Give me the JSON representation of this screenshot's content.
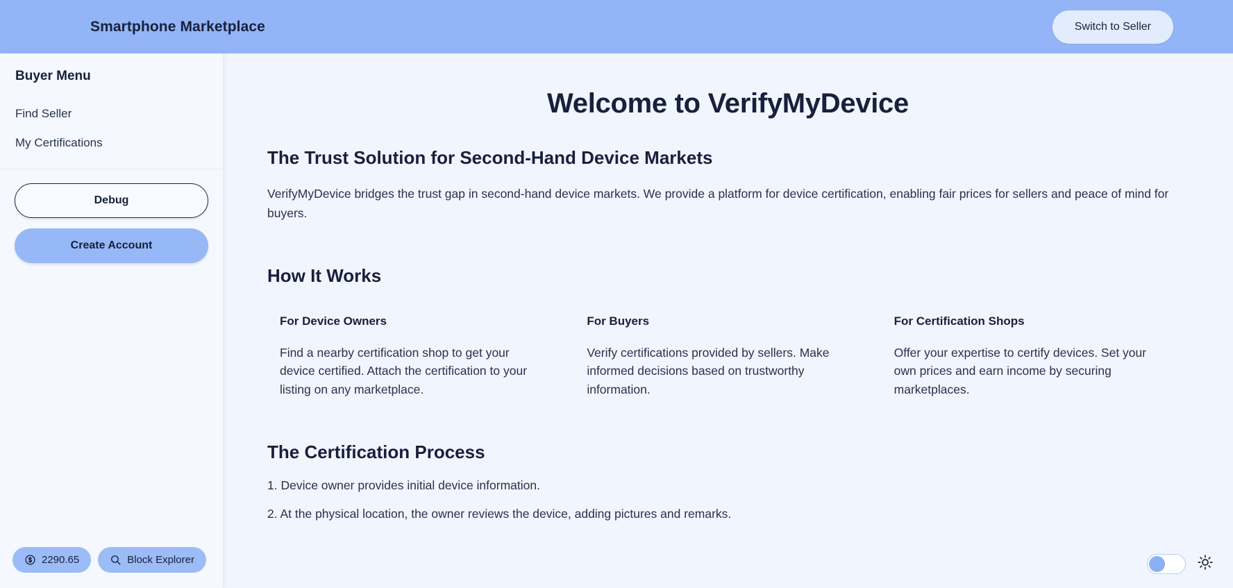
{
  "header": {
    "title": "Smartphone Marketplace",
    "switch_label": "Switch to Seller",
    "bg_color": "#93b5f7"
  },
  "sidebar": {
    "heading": "Buyer Menu",
    "items": [
      {
        "label": "Find Seller"
      },
      {
        "label": "My Certifications"
      }
    ],
    "actions": {
      "debug_label": "Debug",
      "create_account_label": "Create Account"
    },
    "footer": {
      "balance": "2290.65",
      "balance_icon": "dollar-circle-icon",
      "explorer_label": "Block Explorer",
      "explorer_icon": "search-icon"
    }
  },
  "main": {
    "page_title": "Welcome to VerifyMyDevice",
    "trust_heading": "The Trust Solution for Second-Hand Device Markets",
    "trust_paragraph": "VerifyMyDevice bridges the trust gap in second-hand device markets. We provide a platform for device certification, enabling fair prices for sellers and peace of mind for buyers.",
    "how_it_works_heading": "How It Works",
    "columns": [
      {
        "title": "For Device Owners",
        "body": "Find a nearby certification shop to get your device certified. Attach the certification to your listing on any marketplace."
      },
      {
        "title": "For Buyers",
        "body": "Verify certifications provided by sellers. Make informed decisions based on trustworthy information."
      },
      {
        "title": "For Certification Shops",
        "body": "Offer your expertise to certify devices. Set your own prices and earn income by securing marketplaces."
      }
    ],
    "process_heading": "The Certification Process",
    "process_steps": [
      "1. Device owner provides initial device information.",
      "2. At the physical location, the owner reviews the device, adding pictures and remarks."
    ]
  },
  "theme": {
    "toggle_state": "off",
    "toggle_name": "dark-mode-toggle",
    "sun_icon": "sun-icon"
  },
  "colors": {
    "accent": "#93b5f7",
    "chip": "#9cbcf8",
    "main_bg": "#f1f5fd",
    "sidebar_bg": "#f5f8fe",
    "text": "#17203c"
  }
}
